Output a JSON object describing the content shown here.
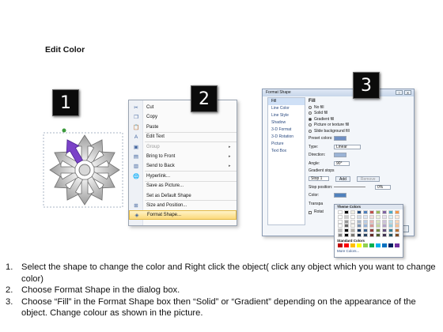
{
  "title": "Edit Color",
  "badges": {
    "one": "1",
    "two": "2",
    "three": "3"
  },
  "context_menu": {
    "items": [
      {
        "label": "Cut",
        "icon": "scissors-icon",
        "glyph": "✂",
        "disabled": false,
        "submenu": false
      },
      {
        "label": "Copy",
        "icon": "copy-icon",
        "glyph": "❐",
        "disabled": false,
        "submenu": false
      },
      {
        "label": "Paste",
        "icon": "paste-icon",
        "glyph": "📋",
        "disabled": false,
        "submenu": false
      },
      {
        "label": "Edit Text",
        "icon": "edit-text-icon",
        "glyph": "A",
        "disabled": false,
        "submenu": false
      },
      {
        "label": "Group",
        "icon": "group-icon",
        "glyph": "▣",
        "disabled": true,
        "submenu": true
      },
      {
        "label": "Bring to Front",
        "icon": "bring-front-icon",
        "glyph": "▤",
        "disabled": false,
        "submenu": true
      },
      {
        "label": "Send to Back",
        "icon": "send-back-icon",
        "glyph": "▥",
        "disabled": false,
        "submenu": true
      },
      {
        "label": "Hyperlink...",
        "icon": "hyperlink-icon",
        "glyph": "🌐",
        "disabled": false,
        "submenu": false
      },
      {
        "label": "Save as Picture...",
        "icon": "",
        "glyph": "",
        "disabled": false,
        "submenu": false
      },
      {
        "label": "Set as Default Shape",
        "icon": "",
        "glyph": "",
        "disabled": false,
        "submenu": false
      },
      {
        "label": "Size and Position...",
        "icon": "size-position-icon",
        "glyph": "⊞",
        "disabled": false,
        "submenu": false
      },
      {
        "label": "Format Shape...",
        "icon": "format-shape-icon",
        "glyph": "◈",
        "disabled": false,
        "submenu": false,
        "highlighted": true
      }
    ]
  },
  "dialog": {
    "title": "Format Shape",
    "nav": [
      "Fill",
      "Line Color",
      "Line Style",
      "Shadow",
      "3-D Format",
      "3-D Rotation",
      "Picture",
      "Text Box"
    ],
    "fill_heading": "Fill",
    "fill_options": [
      "No fill",
      "Solid fill",
      "Gradient fill",
      "Picture or texture fill",
      "Slide background fill"
    ],
    "selected_fill": 2,
    "preset_label": "Preset colors:",
    "type_label": "Type:",
    "type_value": "Linear",
    "direction_label": "Direction:",
    "angle_label": "Angle:",
    "angle_value": "90°",
    "gradient_stops_label": "Gradient stops",
    "stop_value": "Stop 1",
    "add_label": "Add",
    "remove_label": "Remove",
    "stop_position_label": "Stop position:",
    "stop_position_value": "0%",
    "color_label": "Color:",
    "transparency_label": "Transpa",
    "rotate_label": "Rotat",
    "close_label": "Close"
  },
  "palette": {
    "theme_label": "Theme Colors",
    "standard_label": "Standard Colors",
    "more_label": "More Colors...",
    "theme_top": [
      "#ffffff",
      "#000000",
      "#eeece1",
      "#1f497d",
      "#4f81bd",
      "#c0504d",
      "#9bbb59",
      "#8064a2",
      "#4bacc6",
      "#f79646"
    ],
    "standard": [
      "#c00000",
      "#ff0000",
      "#ffc000",
      "#ffff00",
      "#92d050",
      "#00b050",
      "#00b0f0",
      "#0070c0",
      "#002060",
      "#7030a0"
    ]
  },
  "steps": [
    {
      "num": "1.",
      "text": "Select the shape to change the color and Right click the object( click any object which you want to change color)"
    },
    {
      "num": "2.",
      "text": "Choose Format Shape in the dialog box."
    },
    {
      "num": "3.",
      "text": "Choose “Fill” in the Format Shape box then “Solid” or “Gradient” depending on the appearance of the object. Change colour as shown in the picture."
    }
  ]
}
